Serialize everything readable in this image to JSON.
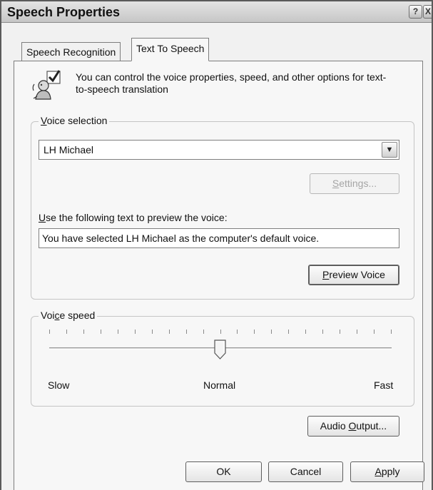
{
  "window": {
    "title": "Speech Properties",
    "help_glyph": "?",
    "close_glyph": "X"
  },
  "tabs": [
    {
      "label": "Speech Recognition",
      "selected": false
    },
    {
      "label": "Text To Speech",
      "selected": true
    }
  ],
  "intro": {
    "icon": "speech-figure-with-checkmark-icon",
    "text": "You can control the voice properties, speed, and other options for text-to-speech translation"
  },
  "voice_selection": {
    "group_label": "Voice selection",
    "selected_voice": "LH Michael",
    "settings_button": "Settings...",
    "settings_enabled": false,
    "preview_label": "Use the following text to preview the voice:",
    "preview_text": "You have selected LH Michael as the computer's default voice.",
    "preview_button": "Preview Voice"
  },
  "voice_speed": {
    "group_label": "Voice speed",
    "labels": {
      "slow": "Slow",
      "normal": "Normal",
      "fast": "Fast"
    },
    "tick_count": 21,
    "position_fraction": 0.5
  },
  "buttons": {
    "audio_output": "Audio Output...",
    "ok": "OK",
    "cancel": "Cancel",
    "apply": "Apply"
  },
  "colors": {
    "dialog_bg": "#f1f1f1",
    "panel_bg": "#f7f7f7",
    "group_border": "#c5c5c5",
    "disabled_text": "#a5a5a5"
  }
}
